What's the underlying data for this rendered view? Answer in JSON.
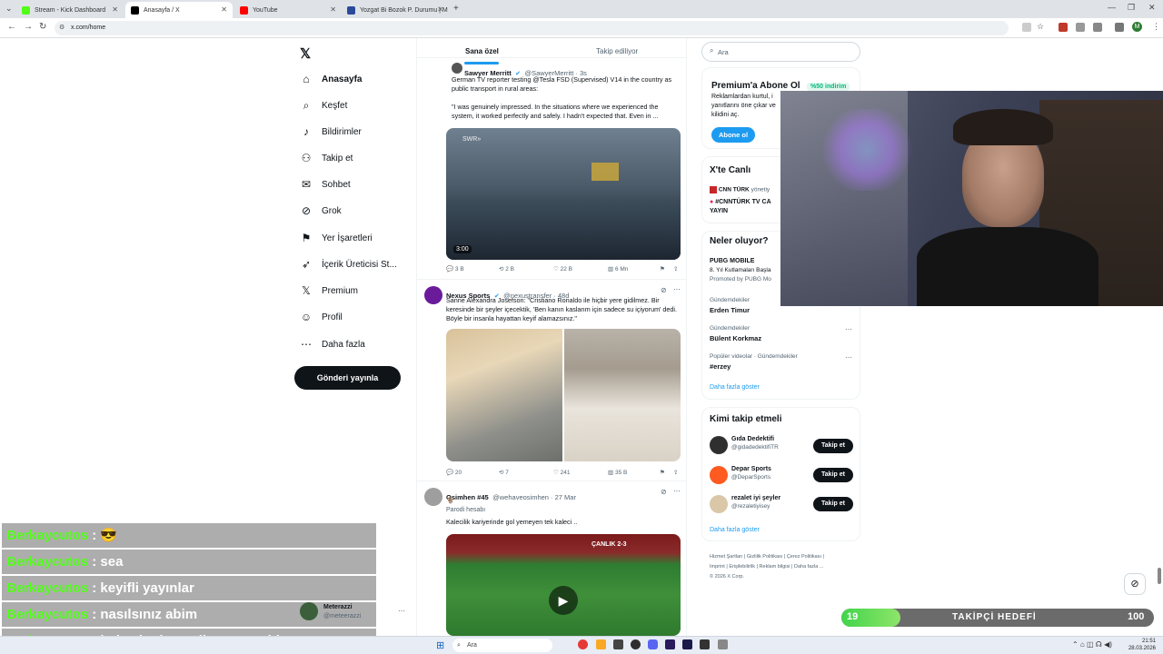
{
  "browser": {
    "tabs": [
      {
        "title": "Stream - Kick Dashboard",
        "favicon_color": "#53fc18",
        "active": false
      },
      {
        "title": "Anasayfa / X",
        "favicon_color": "#000000",
        "active": true
      },
      {
        "title": "YouTube",
        "favicon_color": "#ff0000",
        "active": false
      },
      {
        "title": "Yozgat Bi Bozok P. Durumu | M",
        "favicon_color": "#2b4a9a",
        "active": false
      }
    ],
    "url": "x.com/home",
    "new_tab": "+"
  },
  "left_nav": {
    "items": [
      {
        "label": "Anasayfa",
        "icon": "home-icon",
        "glyph": "⌂"
      },
      {
        "label": "Keşfet",
        "icon": "search-icon",
        "glyph": "⌕"
      },
      {
        "label": "Bildirimler",
        "icon": "bell-icon",
        "glyph": "♪"
      },
      {
        "label": "Takip et",
        "icon": "follow-icon",
        "glyph": "⚇"
      },
      {
        "label": "Sohbet",
        "icon": "mail-icon",
        "glyph": "✉"
      },
      {
        "label": "Grok",
        "icon": "grok-icon",
        "glyph": "⊘"
      },
      {
        "label": "Yer İşaretleri",
        "icon": "bookmark-icon",
        "glyph": "⚑"
      },
      {
        "label": "İçerik Üreticisi St...",
        "icon": "rocket-icon",
        "glyph": "➶"
      },
      {
        "label": "Premium",
        "icon": "x-logo-icon",
        "glyph": "𝕏"
      },
      {
        "label": "Profil",
        "icon": "person-icon",
        "glyph": "☺"
      },
      {
        "label": "Daha fazla",
        "icon": "more-icon",
        "glyph": "⋯"
      }
    ],
    "post_button": "Gönderi yayınla",
    "account": {
      "name": "Meterazzi",
      "handle": "@meteerazzi"
    }
  },
  "feed": {
    "tabs": [
      "Sana özel",
      "Takip ediliyor"
    ],
    "tweets": [
      {
        "name": "Sawyer Merritt",
        "handle": "@SawyerMerritt · 3s",
        "text1": "German TV reporter testing @Tesla FSD (Supervised) V14 in the country as public transport in rural areas:",
        "text2": "\"I was genuinely impressed. In the situations where we experienced the system, it worked perfectly and safely. I hadn't expected that. Even in ...",
        "video_time": "3:00",
        "video_tag": "SWR»",
        "stats": {
          "replies": "3 B",
          "reposts": "2 B",
          "likes": "22 B",
          "views": "6 Mn"
        }
      },
      {
        "name": "Nexus Sports",
        "handle": "@nexustransfer · 48d",
        "text1": "Sanne Alexandra Josefson: \"Cristiano Ronaldo ile hiçbir yere gidilmez. Bir keresinde bir şeyler içecektik, 'Ben kanın kaslarım için sadece su içiyorum' dedi. Böyle bir insanla hayattan keyif alamazsınız.\"",
        "stats": {
          "replies": "20",
          "reposts": "7",
          "likes": "241",
          "views": "35 B"
        }
      },
      {
        "name": "Osimhen #45",
        "handle": "@wehaveosimhen · 27 Mar",
        "emoji": "🐐",
        "label": "Parodi hesabı",
        "text1": "Kalecilik kariyerinde gol yemeyen tek kaleci ..",
        "video_scoreboard": "ÇANLIK 2-3"
      }
    ]
  },
  "right": {
    "search_placeholder": "Ara",
    "premium": {
      "title": "Premium'a Abone Ol",
      "badge": "%50 indirim",
      "desc1": "Reklamlardan kurtul, i",
      "desc2": "yanıtlarını öne çıkar ve",
      "desc3": "kilidini aç.",
      "button": "Abone ol"
    },
    "live": {
      "title": "X'te Canlı",
      "channel": "CNN TÜRK",
      "host": "yönetiy",
      "stream_title": "#CNNTÜRK TV CA",
      "stream_title2": "YAYIN"
    },
    "trends": {
      "title": "Neler oluyor?",
      "items": [
        {
          "name": "PUBG MOBILE",
          "sub": "8. Yıl Kutlamaları Başla",
          "meta": "Promoted by PUBG Mo"
        },
        {
          "meta": "Gündemdekiler",
          "name": "Erden Timur"
        },
        {
          "meta": "Gündemdekiler",
          "name": "Bülent Korkmaz"
        },
        {
          "meta": "Popüler videolar · Gündemdekiler",
          "name": "#erzey"
        }
      ],
      "show_more": "Daha fazla göster"
    },
    "who_to_follow": {
      "title": "Kimi takip etmeli",
      "items": [
        {
          "name": "Gıda Dedektifi",
          "handle": "@gidadedektifiTR",
          "button": "Takip et",
          "avatar_color": "#2f2f2f"
        },
        {
          "name": "Depar Sports",
          "handle": "@DeparSports",
          "button": "Takip et",
          "avatar_color": "#ff5a1f"
        },
        {
          "name": "rezalet iyi şeyler",
          "handle": "@rezaletiyisey",
          "button": "Takip et",
          "avatar_color": "#d9c7a8"
        }
      ],
      "show_more": "Daha fazla göster"
    },
    "footer": {
      "row1": [
        "Hizmet Şartları",
        "Gizlilik Politikası",
        "Çerez Politikası"
      ],
      "row2": [
        "Imprint",
        "Erişilebilirlik",
        "Reklam bilgisi",
        "Daha fazla ..."
      ],
      "copyright": "© 2026 X Corp."
    }
  },
  "chat": [
    {
      "user": "Berkaycutos",
      "sep": " : ",
      "msg": "😎"
    },
    {
      "user": "Berkaycutos",
      "sep": " : ",
      "msg": "sea"
    },
    {
      "user": "Berkaycutos",
      "sep": " : ",
      "msg": "keyifli yayınlar"
    },
    {
      "user": "Berkaycutos",
      "sep": " : ",
      "msg": "nasılsınız abim"
    },
    {
      "user": "Berkaycutos",
      "sep": " : ",
      "msg": "halısahadan geliyom yoruldum aw"
    }
  ],
  "goal": {
    "current": "19",
    "label": "TAKİPÇİ HEDEFİ",
    "target": "100",
    "progress_pct": 19
  },
  "taskbar": {
    "search": "Ara",
    "time": "21:51",
    "date": "28.03.2026"
  },
  "colors": {
    "x_blue": "#1d9bf0",
    "chat_user": "#53ff1a",
    "goal_green": "#41d44b"
  }
}
